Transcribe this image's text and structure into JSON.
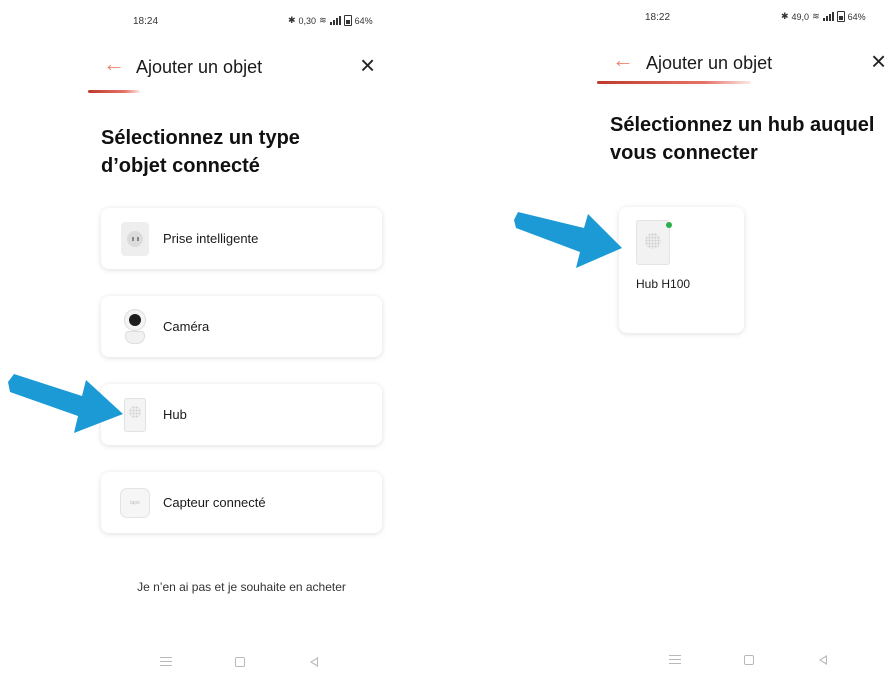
{
  "left_screen": {
    "status": {
      "time": "18:24",
      "net_speed": "0,30",
      "battery": "64%"
    },
    "appbar": {
      "title": "Ajouter un objet",
      "back_icon": "arrow-left-icon",
      "close_icon": "close-icon"
    },
    "heading": "Sélectionnez un type d’objet connecté",
    "types": [
      {
        "label": "Prise intelligente",
        "icon": "smart-plug-icon"
      },
      {
        "label": "Caméra",
        "icon": "camera-icon"
      },
      {
        "label": "Hub",
        "icon": "hub-icon"
      },
      {
        "label": "Capteur connecté",
        "icon": "sensor-icon"
      }
    ],
    "sensor_brand": "tapo",
    "buy_link": "Je n’en ai pas et je souhaite en acheter"
  },
  "right_screen": {
    "status": {
      "time": "18:22",
      "net_speed": "49,0",
      "battery": "64%"
    },
    "appbar": {
      "title": "Ajouter un objet",
      "back_icon": "arrow-left-icon",
      "close_icon": "close-icon"
    },
    "heading": "Sélectionnez un hub auquel vous connecter",
    "hub": {
      "name": "Hub H100",
      "status_color": "#2fae4e"
    }
  },
  "colors": {
    "accent": "#e9866c",
    "arrow": "#1b9ad6"
  }
}
